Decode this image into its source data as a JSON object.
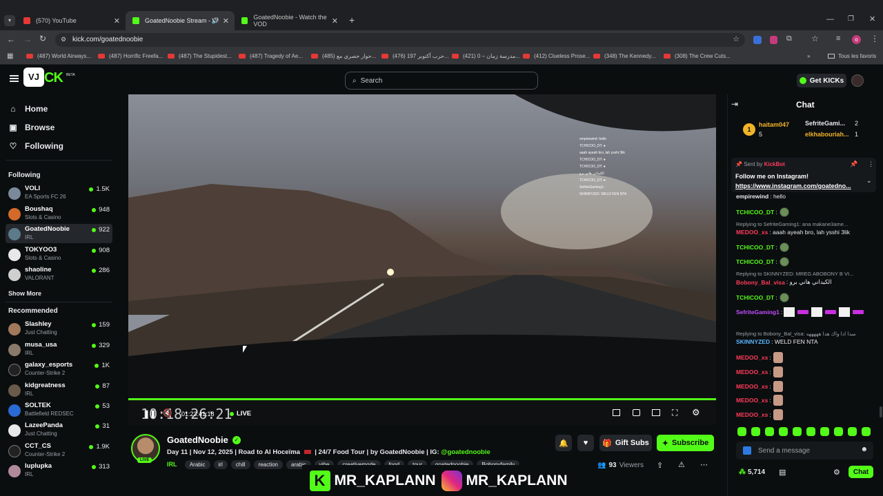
{
  "browser": {
    "tabs": [
      {
        "title": "(570) YouTube",
        "fav_color": "#e53935"
      },
      {
        "title": "GoatedNoobie Stream - W",
        "fav_color": "#53fc18"
      },
      {
        "title": "GoatedNoobie - Watch the VOD",
        "fav_color": "#53fc18"
      }
    ],
    "url": "kick.com/goatednoobie",
    "bookmarks": [
      "(487) World Airways...",
      "(487) Horrific Freefa...",
      "(487) The Stupidest...",
      "(487) Tragedy of Ae...",
      "(485) حوار حصري مع...",
      "(476) حرب أكتوبر 197...",
      "(421) مدرسة زمان – 0...",
      "(412) Clueless Prose...",
      "(348) The Kennedy...",
      "(308) The Crew Cuts..."
    ],
    "all_bookmarks": "Tous les favoris"
  },
  "header": {
    "logo_text": "VJ",
    "logo_kick": "CK",
    "beta": "BETA",
    "search_placeholder": "Search",
    "get_kicks": "Get KICKs"
  },
  "sidebar": {
    "nav": [
      {
        "label": "Home",
        "icon": "home-icon"
      },
      {
        "label": "Browse",
        "icon": "browse-icon"
      },
      {
        "label": "Following",
        "icon": "heart-icon"
      }
    ],
    "following_title": "Following",
    "following": [
      {
        "name": "VOLI",
        "category": "EA Sports FC 26",
        "viewers": "1.5K",
        "color": "#7a8a9a"
      },
      {
        "name": "Boushaq",
        "category": "Slots & Casino",
        "viewers": "948",
        "color": "#d46a2a"
      },
      {
        "name": "GoatedNoobie",
        "category": "IRL",
        "viewers": "922",
        "color": "#5b7a8a"
      },
      {
        "name": "TOKYOO3",
        "category": "Slots & Casino",
        "viewers": "908",
        "color": "#e8e8e8"
      },
      {
        "name": "shaoline",
        "category": "VALORANT",
        "viewers": "286",
        "color": "#cfcfcf"
      }
    ],
    "show_more": "Show More",
    "recommended_title": "Recommended",
    "recommended": [
      {
        "name": "Slashley",
        "category": "Just Chatting",
        "viewers": "159",
        "color": "#a0785a"
      },
      {
        "name": "musa_usa",
        "category": "IRL",
        "viewers": "329",
        "color": "#8a7a6a"
      },
      {
        "name": "galaxy_esports",
        "category": "Counter-Strike 2",
        "viewers": "1K",
        "color": "#222"
      },
      {
        "name": "kidgreatness",
        "category": "IRL",
        "viewers": "87",
        "color": "#6a5a4a"
      },
      {
        "name": "SOLTEK",
        "category": "Battlefield REDSEC",
        "viewers": "53",
        "color": "#2a6ad4"
      },
      {
        "name": "LazeePanda",
        "category": "Just Chatting",
        "viewers": "31",
        "color": "#e8e8e8"
      },
      {
        "name": "CCT_CS",
        "category": "Counter-Strike 2",
        "viewers": "1.9K",
        "color": "#222"
      },
      {
        "name": "luplupka",
        "category": "IRL",
        "viewers": "313",
        "color": "#b08a9a"
      }
    ]
  },
  "player": {
    "overlay_clock": "10:18:26:21",
    "elapsed": "01:23:41:18",
    "live_label": "LIVE",
    "stream_overlay_chat": [
      "empirewind: hello",
      "TCHICOO_DT: ●",
      "aaah ayeah bro, lah ysshi 3lik",
      "TCHICOO_DT: ●",
      "TCHICOO_DT: ●",
      "الكيداني هاني برو",
      "TCHICOO_DT: ●",
      "SefriteGaming1:",
      "SKINNYZED: WELD FEN NTA"
    ]
  },
  "streamer": {
    "name": "GoatedNoobie",
    "live_badge": "LIVE",
    "title_prefix": "Day 11 | Nov 12, 2025 | Road to Al Hoceïma",
    "title_suffix": "| 24/7 Food Tour | by GoatedNoobie | IG:",
    "ig_handle": "@goatednoobie",
    "category": "IRL",
    "tags": [
      "Arabic",
      "irl",
      "chill",
      "reaction",
      "arabic",
      "vibe",
      "creativemode",
      "food",
      "tour",
      "goatednoobie",
      "Bobonyfamily"
    ],
    "viewers": "93",
    "viewers_label": "Viewers",
    "gift_subs": "Gift Subs",
    "subscribe": "Subscribe"
  },
  "watermark": {
    "left": "MR_KAPLANN",
    "right": "MR_KAPLANN"
  },
  "chat": {
    "title": "Chat",
    "leaderboard": [
      {
        "name": "haitam047",
        "score": "5",
        "rank": "1"
      },
      {
        "name": "SefriteGami...",
        "score": "2"
      },
      {
        "name": "elkhabouriah...",
        "score": "1"
      }
    ],
    "pinned": {
      "sent_by": "Sent by",
      "sender": "KickBot",
      "line1": "Follow me on Instagram!",
      "line2": "https://www.instagram.com/goatedno..."
    },
    "messages": [
      {
        "type": "msg",
        "user": "empirewind",
        "color": "#e8eaed",
        "text": ": hello",
        "emote": "none"
      },
      {
        "type": "msg",
        "user": "TCHICOO_DT",
        "color": "#53fc18",
        "text": ":",
        "emote": "pepe"
      },
      {
        "type": "reply",
        "text": "Replying to SefriteGaming1: ana makane3ame..."
      },
      {
        "type": "msg",
        "user": "MEDOO_xs",
        "color": "#ff3b5c",
        "text": ": aaah ayeah bro, lah ysshi 3lik",
        "emote": "none"
      },
      {
        "type": "msg",
        "user": "TCHICOO_DT",
        "color": "#53fc18",
        "text": ":",
        "emote": "pepe"
      },
      {
        "type": "msg",
        "user": "TCHICOO_DT",
        "color": "#53fc18",
        "text": ":",
        "emote": "pepe"
      },
      {
        "type": "reply",
        "text": "Replying to SKINNYZED: MREG ABOBONY B VI..."
      },
      {
        "type": "msg",
        "user": "Bobony_Bal_visa",
        "color": "#ff3b5c",
        "text": ": الكيداني هاني برو",
        "emote": "none"
      },
      {
        "type": "msg",
        "user": "TCHICOO_DT",
        "color": "#53fc18",
        "text": ":",
        "emote": "pepe"
      },
      {
        "type": "msg",
        "user": "SefriteGaming1",
        "color": "#c44dff",
        "text": ":",
        "emote": "boxes"
      },
      {
        "type": "reply",
        "text": "Replying to Bobony_Bal_visa: مبدا ادا واك هدا هههههه"
      },
      {
        "type": "msg",
        "user": "SKINNYZED",
        "color": "#5ab4ff",
        "text": ": WELD FEN NTA",
        "emote": "none"
      },
      {
        "type": "msg",
        "user": "MEDOO_xs",
        "color": "#ff3b5c",
        "text": ":",
        "emote": "face"
      },
      {
        "type": "msg",
        "user": "MEDOO_xs",
        "color": "#ff3b5c",
        "text": ":",
        "emote": "face"
      },
      {
        "type": "msg",
        "user": "MEDOO_xs",
        "color": "#ff3b5c",
        "text": ":",
        "emote": "face"
      },
      {
        "type": "msg",
        "user": "MEDOO_xs",
        "color": "#ff3b5c",
        "text": ":",
        "emote": "face"
      },
      {
        "type": "msg",
        "user": "MEDOO_xs",
        "color": "#ff3b5c",
        "text": ":",
        "emote": "face"
      }
    ],
    "input_placeholder": "Send a message",
    "kicks_balance": "5,714",
    "chat_button": "Chat"
  }
}
